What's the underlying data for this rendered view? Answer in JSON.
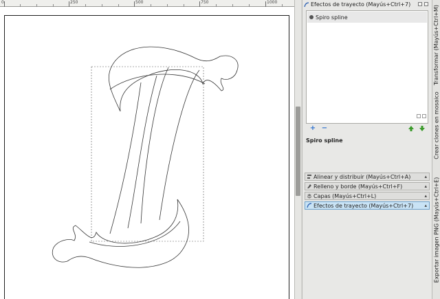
{
  "ruler": {
    "labels": [
      "0",
      "250",
      "500",
      "750",
      "1000"
    ]
  },
  "dock": {
    "title": "Efectos de trayecto (Mayús+Ctrl+7)",
    "effects": [
      {
        "label": "Spiro spline"
      }
    ],
    "add_label": "+",
    "remove_label": "−",
    "current_effect_title": "Spiro spline",
    "panels": [
      {
        "label": "Alinear y distribuir (Mayús+Ctrl+A)",
        "expanded": false
      },
      {
        "label": "Relleno y borde (Mayús+Ctrl+F)",
        "expanded": false
      },
      {
        "label": "Capas (Mayús+Ctrl+L)",
        "expanded": false
      },
      {
        "label": "Efectos de trayecto (Mayús+Ctrl+7)",
        "expanded": true
      }
    ]
  },
  "side_tabs": [
    {
      "label": "Transformar (Mayús+Ctrl+M)"
    },
    {
      "label": "Crear clones en mosaico"
    },
    {
      "label": "Exportar imagen PNG (Mayús+Ctrl+E)"
    }
  ],
  "colors": {
    "active_panel": "#c9e3f5",
    "arrow_green": "#3a9a2a",
    "add_blue": "#2a6fcf"
  }
}
